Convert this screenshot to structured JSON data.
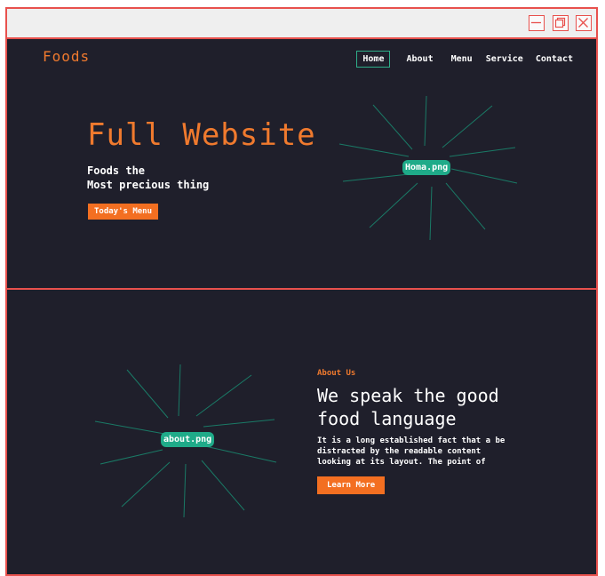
{
  "window": {
    "controls": {
      "minimize_icon": "minimize-icon",
      "maximize_icon": "maximize-icon",
      "close_icon": "close-icon"
    }
  },
  "header": {
    "logo": "Foods",
    "nav": [
      {
        "label": "Home",
        "active": true
      },
      {
        "label": "About"
      },
      {
        "label": "Menu"
      },
      {
        "label": "Service"
      },
      {
        "label": "Contact"
      }
    ]
  },
  "hero": {
    "title": "Full Website",
    "subtitle_line1": "Foods the",
    "subtitle_line2": "Most precious thing",
    "button": "Today's Menu",
    "image_label": "Homa.png"
  },
  "about": {
    "tag": "About Us",
    "title": "We speak the good food language",
    "text": "It is a long established fact that a be distracted by the readable content looking at its layout. The point of",
    "button": "Learn More",
    "image_label": "about.png"
  },
  "colors": {
    "accent": "#f07a2e",
    "button": "#f36f21",
    "teal": "#1fab89",
    "background": "#1f1f2b",
    "frame": "#e8514d"
  }
}
